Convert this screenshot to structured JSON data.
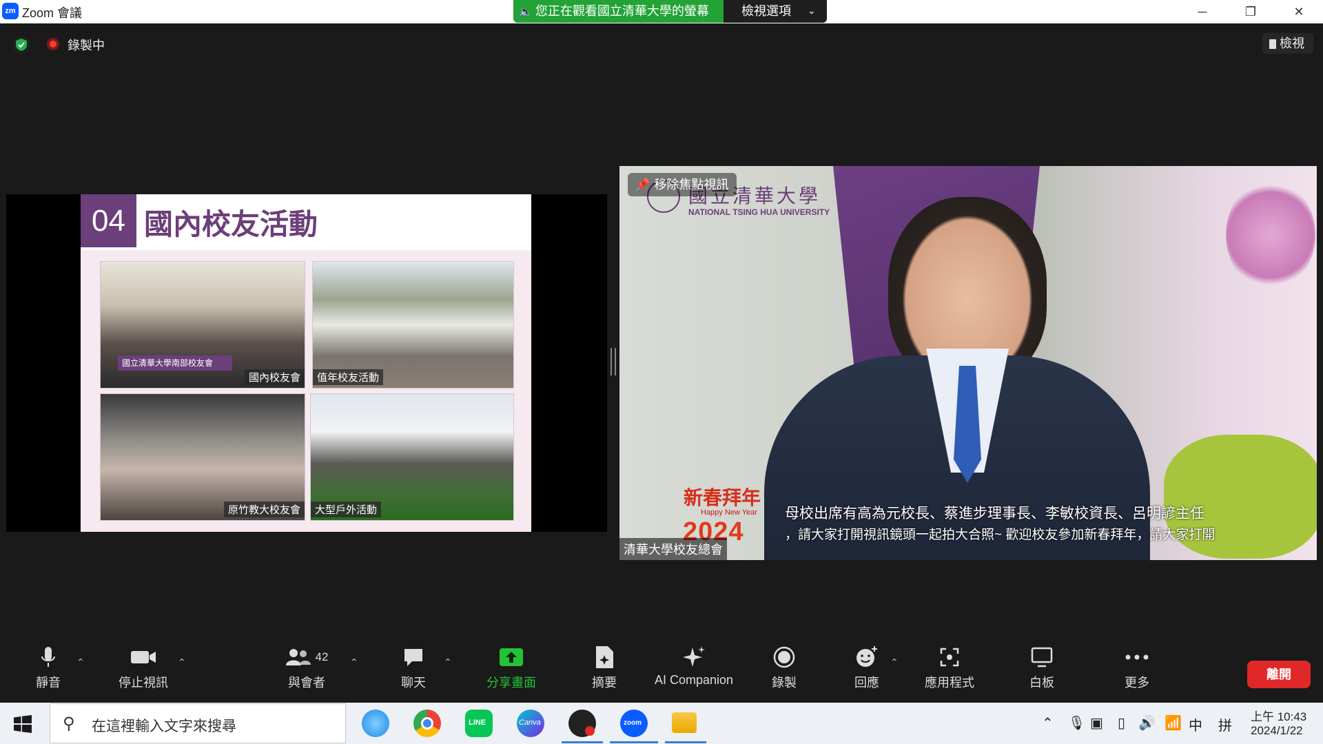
{
  "window": {
    "logo_text": "zm",
    "title": "Zoom 會議",
    "share_banner": "您正在觀看國立清華大學的螢幕",
    "view_options": "檢視選項",
    "controls": [
      "─",
      "❐",
      "✕"
    ]
  },
  "meeting_bar": {
    "recording_label": "錄製中",
    "view_button": "檢視"
  },
  "slide": {
    "number": "04",
    "title": "國內校友活動",
    "banner_text": "國立清華大學南部校友會",
    "photos": [
      {
        "caption": "國內校友會"
      },
      {
        "caption": "值年校友活動"
      },
      {
        "caption": "原竹教大校友會"
      },
      {
        "caption": "大型戶外活動"
      }
    ]
  },
  "video": {
    "pin_label": "移除焦點視訊",
    "logo_cn": "國立清華大學",
    "logo_en": "NATIONAL TSING HUA UNIVERSITY",
    "participant_name": "清華大學校友總會",
    "cny_title": "新春拜年",
    "cny_sub": "Happy New Year",
    "cny_year": "2024",
    "subtitle_line1": "母校出席有高為元校長、蔡進步理事長、李敏校資長、呂明諺主任",
    "subtitle_line2": "，請大家打開視訊鏡頭一起拍大合照~ 歡迎校友參加新春拜年，請大家打開"
  },
  "toolbar": {
    "mute": "靜音",
    "video": "停止視訊",
    "participants": "與會者",
    "participants_count": "42",
    "chat": "聊天",
    "share": "分享畫面",
    "summary": "摘要",
    "ai": "AI Companion",
    "record": "錄製",
    "reactions": "回應",
    "apps": "應用程式",
    "whiteboard": "白板",
    "more": "更多",
    "leave": "離開"
  },
  "taskbar": {
    "search_placeholder": "在這裡輸入文字來搜尋",
    "apps": [
      "Internet Explorer",
      "Chrome",
      "LINE",
      "Canva",
      "OBS",
      "Zoom",
      "File Explorer"
    ],
    "app_labels": {
      "line": "LINE",
      "canva": "Canva",
      "zoom": "zoom"
    },
    "tray_ime": "中",
    "tray_ime2": "拼",
    "time": "上午 10:43",
    "date": "2024/1/22"
  },
  "colors": {
    "zoom_blue": "#0b5cff",
    "share_green": "#23a336",
    "slide_purple": "#6b3f79",
    "leave_red": "#e02828"
  }
}
